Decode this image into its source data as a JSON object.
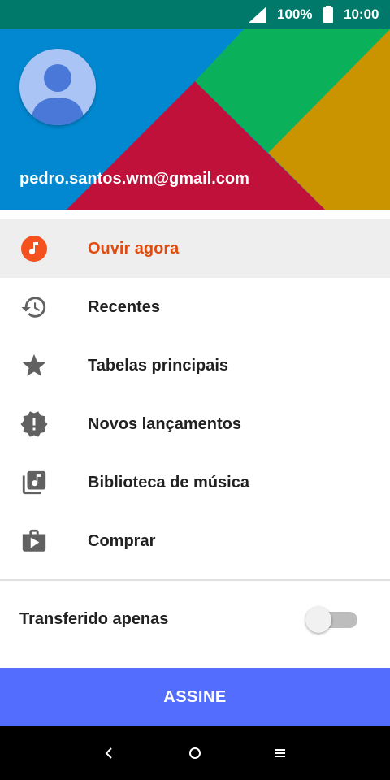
{
  "status_bar": {
    "battery_percent": "100%",
    "time": "10:00",
    "icons": [
      "signal-icon",
      "battery-icon"
    ]
  },
  "header": {
    "account_email": "pedro.santos.wm@gmail.com",
    "colors": {
      "blue": "#0288d1",
      "green": "#0bb05a",
      "gold": "#c99400",
      "red": "#c0113a",
      "avatar": "#a9c4f5"
    }
  },
  "menu": {
    "items": [
      {
        "label": "Ouvir agora",
        "icon": "music-note-icon",
        "active": true
      },
      {
        "label": "Recentes",
        "icon": "history-icon"
      },
      {
        "label": "Tabelas principais",
        "icon": "star-icon"
      },
      {
        "label": "Novos lançamentos",
        "icon": "new-releases-icon"
      },
      {
        "label": "Biblioteca de música",
        "icon": "library-music-icon"
      },
      {
        "label": "Comprar",
        "icon": "shop-icon"
      }
    ],
    "active_color": "#e04c0f"
  },
  "downloaded_only": {
    "label": "Transferido apenas",
    "enabled": false
  },
  "subscribe": {
    "label": "ASSINE",
    "color": "#536dfe"
  },
  "nav_bar": {
    "icons": [
      "back-icon",
      "home-icon",
      "recents-icon"
    ]
  }
}
